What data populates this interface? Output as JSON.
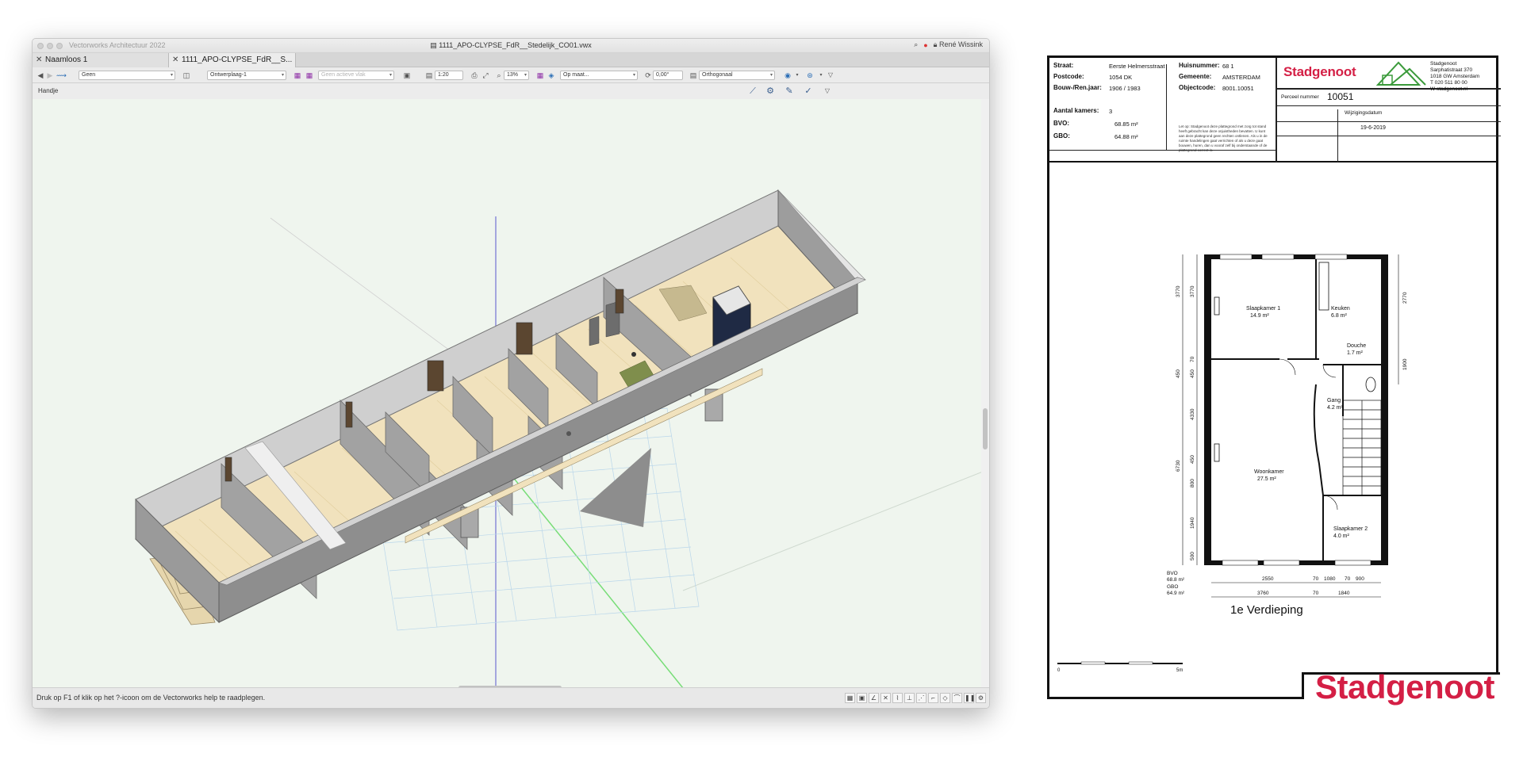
{
  "window": {
    "app_name": "Vectorworks Architectuur 2022",
    "document_title": "1111_APO-CLYPSE_FdR__Stedelijk_CO01.vwx",
    "user": "René Wissink",
    "tabs": [
      {
        "label": "Naamloos 1",
        "active": false
      },
      {
        "label": "1111_APO-CLYPSE_FdR__S...",
        "active": true
      }
    ]
  },
  "toolbar": {
    "class_select": "Geen",
    "layer_select": "Ontwerplaag-1",
    "plane_select": "Geen actieve vlak",
    "scale": "1:20",
    "zoom": "13%",
    "view_select": "Op maat...",
    "angle": "0,00°",
    "projection": "Orthogonaal"
  },
  "tool_bar2": {
    "tool_name": "Handje"
  },
  "status": {
    "text": "Druk op F1 of klik op het ?-icoon om de Vectorworks help te raadplegen."
  },
  "colors": {
    "brand_red": "#d41f45",
    "viewport_bg": "#eff5ee",
    "wall_gray": "#8e8e8e",
    "floor_wood": "#f1e2bd"
  },
  "sheet": {
    "brand": "Stadgenoot",
    "contact": [
      "Stadgenoot",
      "Sarphatistraat 370",
      "1018 GW  Amsterdam",
      "T  020 511 80 00",
      "W stadgenoot.nl"
    ],
    "fields": {
      "straat_label": "Straat:",
      "straat": "Eerste Helmersstraat",
      "postcode_label": "Postcode:",
      "postcode": "1054 DK",
      "bouwjaar_label": "Bouw-/Ren.jaar:",
      "bouwjaar": "1906  /  1983",
      "huisnummer_label": "Huisnummer:",
      "huisnummer": "68  1",
      "gemeente_label": "Gemeente:",
      "gemeente": "AMSTERDAM",
      "objectcode_label": "Objectcode:",
      "objectcode": "8001.10051",
      "kamers_label": "Aantal kamers:",
      "kamers": "3",
      "bvo_label": "BVO:",
      "bvo": "68.85 m²",
      "gbo_label": "GBO:",
      "gbo": "64.88 m²"
    },
    "perceel_label": "Perceel nummer",
    "perceel": "10051",
    "wijziging_label": "Wijzigingsdatum",
    "wijziging": "19-6-2019",
    "note": "Let op: Stadgenoot deze plattegrond met zorg tot stand heeft gebracht kan deze onjuistheden bevatten. U kunt aan deze plattegrond geen rechten ontlenen. Als u in de ruimte handelingen gaat verrichten of als u deze gaat bouwen, huren, dan u vooraf zelf bij onderstaande of de plattegrond correct is.",
    "rooms": [
      {
        "name": "Slaapkamer 1",
        "area": "14.9 m²"
      },
      {
        "name": "Keuken",
        "area": "6.8 m²"
      },
      {
        "name": "Douche",
        "area": "1.7 m²"
      },
      {
        "name": "Gang",
        "area": "4.2 m²"
      },
      {
        "name": "Woonkamer",
        "area": "27.5 m²"
      },
      {
        "name": "Slaapkamer 2",
        "area": "4.0 m²"
      }
    ],
    "dims_left": [
      "3770",
      "3770",
      "70",
      "450",
      "450",
      "4330",
      "6730",
      "450",
      "800",
      "1940",
      "500"
    ],
    "dims_right": [
      "2770",
      "1900"
    ],
    "dims_bottom_1": [
      "2550",
      "70",
      "1080",
      "70",
      "900"
    ],
    "dims_bottom_2": [
      "3760",
      "70",
      "1840"
    ],
    "totals": [
      "BVO",
      "68.8 m²",
      "GBO",
      "64.9 m²"
    ],
    "plan_title": "1e Verdieping",
    "scale_start": "0",
    "scale_end": "5m"
  }
}
